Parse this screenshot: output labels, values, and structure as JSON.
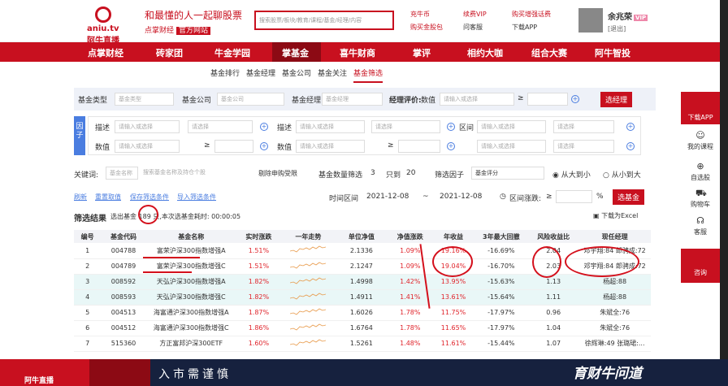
{
  "header": {
    "logo_text": "aniu.tv 阿牛直播",
    "slogan": "和最懂的人一起聊股票",
    "brand": "点掌财经",
    "brand_tag": "官方网站",
    "search_placeholder": "搜索股票/板块/教育/课程/基金/经理/内容",
    "links": [
      "充牛币",
      "续费VIP",
      "购买增强话费",
      "购买金股包",
      "问客服",
      "下载APP"
    ],
    "user_name": "余兆荣",
    "vip_badge": "VIP",
    "logout": "[退出]"
  },
  "nav": {
    "items": [
      "点掌财经",
      "砖家团",
      "牛金学园",
      "掌基金",
      "喜牛财商",
      "掌评",
      "相约大咖",
      "组合大赛",
      "阿牛智投"
    ]
  },
  "subnav": [
    "基金排行",
    "基金经理",
    "基金公司",
    "基金关注",
    "基金筛选"
  ],
  "filter": {
    "fund_type_label": "基金类型",
    "fund_type_ph": "基金类型",
    "company_label": "基金公司",
    "company_ph": "基金公司",
    "manager_label": "基金经理",
    "manager_ph": "基金经理",
    "rating_label": "经理评价:",
    "rating_value": "数值",
    "rating_ph": "请输入或选择",
    "gte": "≥",
    "select_manager": "选经理",
    "factor_label": "因子",
    "desc_label": "描述",
    "value_label": "数值",
    "interval_label": "区间",
    "input_ph": "请输入或选择",
    "select_ph": "请选择"
  },
  "options": {
    "keyword_label": "关键词:",
    "keyword_type": "基金名称",
    "keyword_ph": "搜索基金名称及持仓个股",
    "exclude": "剔除申购受限",
    "count_filter": "基金数量筛选",
    "count_a": "3",
    "only": "只到",
    "count_b": "20",
    "factor_select": "筛选因子",
    "factor_value": "基金评分",
    "sort_desc": "从大到小",
    "sort_asc": "从小到大"
  },
  "actions": {
    "refresh": "刷新",
    "reset": "重置取值",
    "save": "保存筛选条件",
    "import": "导入筛选条件",
    "time_label": "时间区间",
    "date_from": "2021-12-08",
    "date_sep": "~",
    "date_to": "2021-12-08",
    "range_label": "区间涨跌:",
    "range_gte": "≥",
    "pct": "%",
    "select_fund": "选基金"
  },
  "result": {
    "title": "筛选结果",
    "prefix": "选出基金",
    "count": "189",
    "suffix": "只,本次选基金耗时:",
    "time": "00:00:05",
    "download": "下载为Excel"
  },
  "columns": [
    "编号",
    "基金代码",
    "基金名称",
    "实时涨跌",
    "一年走势",
    "单位净值",
    "净值涨跌",
    "年收益",
    "3年最大回撤",
    "风险收益比",
    "现任经理"
  ],
  "rows": [
    {
      "no": "1",
      "code": "004788",
      "name": "富荣沪深300指数增强A",
      "rt": "1.51%",
      "nav": "2.1336",
      "chg": "1.09%",
      "yr": "19.16%",
      "dd": "-16.69%",
      "rr": "2.04",
      "mgr": "邓宇翔:84 郎骋成:72"
    },
    {
      "no": "2",
      "code": "004789",
      "name": "富荣沪深300指数增强C",
      "rt": "1.51%",
      "nav": "2.1247",
      "chg": "1.09%",
      "yr": "19.04%",
      "dd": "-16.70%",
      "rr": "2.03",
      "mgr": "邓宇翔:84 郎骋成:72"
    },
    {
      "no": "3",
      "code": "008592",
      "name": "天弘沪深300指数增强A",
      "rt": "1.82%",
      "nav": "1.4998",
      "chg": "1.42%",
      "yr": "13.95%",
      "dd": "-15.63%",
      "rr": "1.13",
      "mgr": "杨超:88"
    },
    {
      "no": "4",
      "code": "008593",
      "name": "天弘沪深300指数增强C",
      "rt": "1.82%",
      "nav": "1.4911",
      "chg": "1.41%",
      "yr": "13.61%",
      "dd": "-15.64%",
      "rr": "1.11",
      "mgr": "杨超:88"
    },
    {
      "no": "5",
      "code": "004513",
      "name": "海富通沪深300指数增强A",
      "rt": "1.87%",
      "nav": "1.6026",
      "chg": "1.78%",
      "yr": "11.75%",
      "dd": "-17.97%",
      "rr": "0.96",
      "mgr": "朱斌全:76"
    },
    {
      "no": "6",
      "code": "004512",
      "name": "海富通沪深300指数增强C",
      "rt": "1.86%",
      "nav": "1.6764",
      "chg": "1.78%",
      "yr": "11.65%",
      "dd": "-17.97%",
      "rr": "1.04",
      "mgr": "朱斌全:76"
    },
    {
      "no": "7",
      "code": "515360",
      "name": "方正富邦沪深300ETF",
      "rt": "1.60%",
      "nav": "1.5261",
      "chg": "1.48%",
      "yr": "11.61%",
      "dd": "-15.44%",
      "rr": "1.07",
      "mgr": "徐辉琳:49 张璐珺:..."
    }
  ],
  "sidebar": [
    "下载APP",
    "我的课程",
    "自选股",
    "购物车",
    "客服",
    "咨询"
  ],
  "footer": {
    "logo": "阿牛直播",
    "ticker": "入市需谨慎",
    "brand": "育财牛问道"
  },
  "colors": {
    "brand_red": "#c8101f",
    "link_blue": "#4a7de0",
    "nav_dark": "#8c0a14",
    "footer_bg": "#16213e"
  }
}
